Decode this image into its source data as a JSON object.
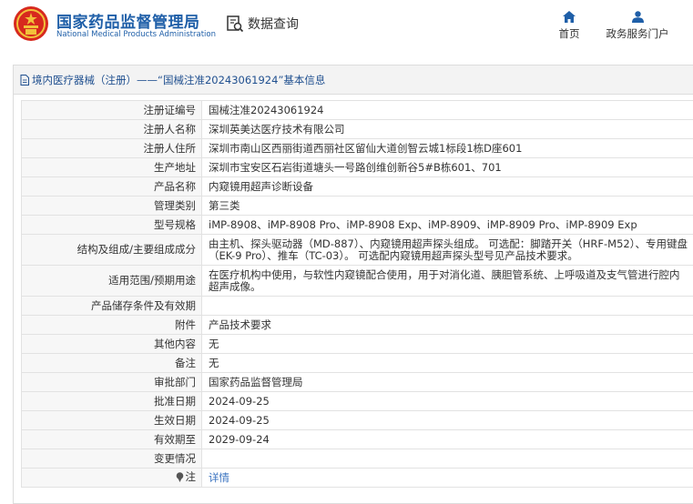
{
  "header": {
    "org_cn": "国家药品监督管理局",
    "org_en": "National Medical Products Administration",
    "query_label": "数据查询",
    "nav": [
      {
        "label": "首页",
        "icon": "home-icon"
      },
      {
        "label": "政务服务门户",
        "icon": "user-icon"
      }
    ]
  },
  "panel": {
    "title": "境内医疗器械（注册）——“国械注准20243061924”基本信息"
  },
  "rows": [
    {
      "key": "注册证编号",
      "value": "国械注准20243061924"
    },
    {
      "key": "注册人名称",
      "value": "深圳英美达医疗技术有限公司"
    },
    {
      "key": "注册人住所",
      "value": "深圳市南山区西丽街道西丽社区留仙大道创智云城1标段1栋D座601"
    },
    {
      "key": "生产地址",
      "value": "深圳市宝安区石岩街道塘头一号路创维创新谷5#B栋601、701"
    },
    {
      "key": "产品名称",
      "value": "内窥镜用超声诊断设备"
    },
    {
      "key": "管理类别",
      "value": "第三类"
    },
    {
      "key": "型号规格",
      "value": "iMP-8908、iMP-8908 Pro、iMP-8908 Exp、iMP-8909、iMP-8909 Pro、iMP-8909 Exp"
    },
    {
      "key": "结构及组成/主要组成成分",
      "value": "由主机、探头驱动器（MD-887）、内窥镜用超声探头组成。 可选配：脚踏开关（HRF-M52）、专用键盘（EK-9 Pro）、推车（TC-03）。 可选配内窥镜用超声探头型号见产品技术要求。"
    },
    {
      "key": "适用范围/预期用途",
      "value": "在医疗机构中使用，与软性内窥镜配合使用，用于对消化道、胰胆管系统、上呼吸道及支气管进行腔内超声成像。"
    },
    {
      "key": "产品储存条件及有效期",
      "value": ""
    },
    {
      "key": "附件",
      "value": "产品技术要求"
    },
    {
      "key": "其他内容",
      "value": "无"
    },
    {
      "key": "备注",
      "value": "无"
    },
    {
      "key": "审批部门",
      "value": "国家药品监督管理局"
    },
    {
      "key": "批准日期",
      "value": "2024-09-25"
    },
    {
      "key": "生效日期",
      "value": "2024-09-25"
    },
    {
      "key": "有效期至",
      "value": "2029-09-24"
    },
    {
      "key": "变更情况",
      "value": ""
    }
  ],
  "note_row": {
    "key": "注",
    "link": "详情"
  },
  "colors": {
    "brand_blue": "#1f5fa8",
    "link_blue": "#3a73c0",
    "key_bg": "#f7f7f7",
    "emblem_red": "#d7291e"
  }
}
